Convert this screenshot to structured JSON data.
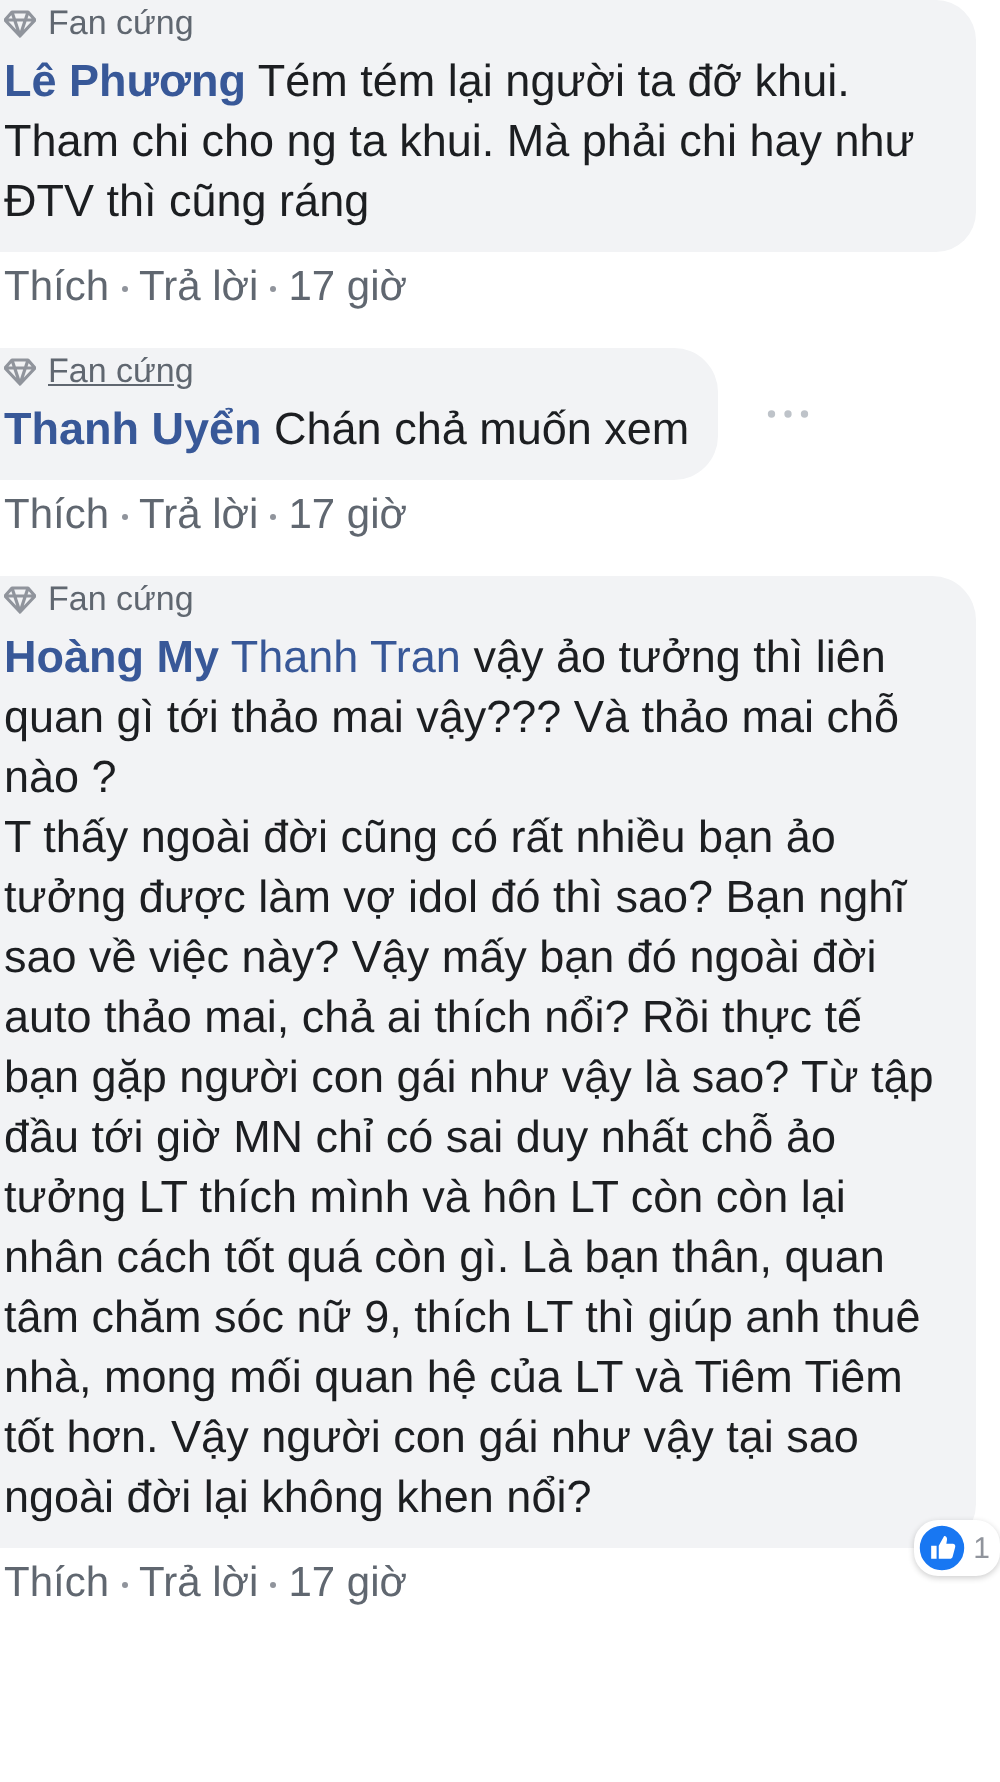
{
  "comments": [
    {
      "badge": {
        "label": "Fan cứng",
        "hovered": false
      },
      "author": "Lê Phương",
      "text": "Tém tém lại người ta đỡ khui. Tham chi cho ng ta khui. Mà phải chi hay như ĐTV thì cũng ráng",
      "actions": [
        "Thích",
        "Trả lời",
        "17 giờ"
      ],
      "more_menu": false
    },
    {
      "badge": {
        "label": "Fan cứng",
        "hovered": true
      },
      "author": "Thanh Uyển",
      "text": "Chán chả muốn xem",
      "actions": [
        "Thích",
        "Trả lời",
        "17 giờ"
      ],
      "more_menu": true
    },
    {
      "badge": {
        "label": "Fan cứng",
        "hovered": false
      },
      "author": "Hoàng My",
      "mention": "Thanh Tran",
      "text": "vậy ảo tưởng thì liên quan gì tới thảo mai vậy??? Và thảo mai chỗ nào ?\nT thấy ngoài đời cũng có rất nhiều bạn ảo tưởng được làm vợ idol đó thì sao? Bạn nghĩ sao về việc này? Vậy mấy bạn đó ngoài đời auto thảo mai, chả ai thích nổi? Rồi thực tế bạn gặp người con gái như vậy là sao? Từ tập đầu tới giờ MN chỉ có sai duy nhất chỗ ảo tưởng LT thích mình và hôn LT còn còn lại nhân cách tốt quá còn gì. Là bạn thân, quan tâm chăm sóc nữ 9, thích LT thì giúp anh thuê nhà, mong mối quan hệ của LT và Tiêm Tiêm tốt hơn. Vậy người con gái như vậy tại sao ngoài đời lại không khen nổi?",
      "actions": [
        "Thích",
        "Trả lời",
        "17 giờ"
      ],
      "more_menu": false,
      "reaction_count": "1"
    }
  ]
}
